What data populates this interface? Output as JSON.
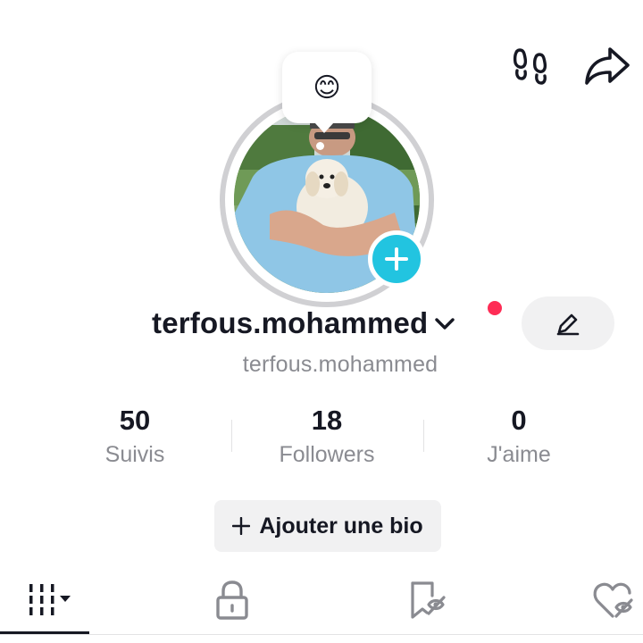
{
  "header": {
    "icons": {
      "footprints": "footprints-icon",
      "share": "share-arrow-icon"
    }
  },
  "avatar": {
    "status_emoji": "😊",
    "ring_color": "#d0d0d3",
    "add_button_color": "#22c4e0"
  },
  "profile": {
    "display_name": "terfous.mohammed",
    "handle": "terfous.mohammed",
    "notification_dot_color": "#fe2c55"
  },
  "stats": [
    {
      "value": "50",
      "label": "Suivis"
    },
    {
      "value": "18",
      "label": "Followers"
    },
    {
      "value": "0",
      "label": "J'aime"
    }
  ],
  "bio_button": {
    "label": "Ajouter une bio"
  },
  "tabs": [
    {
      "icon": "videos-grid-icon",
      "selected": true
    },
    {
      "icon": "lock-icon",
      "selected": false
    },
    {
      "icon": "saved-bookmark-icon",
      "selected": false
    },
    {
      "icon": "liked-heart-icon",
      "selected": false
    }
  ]
}
